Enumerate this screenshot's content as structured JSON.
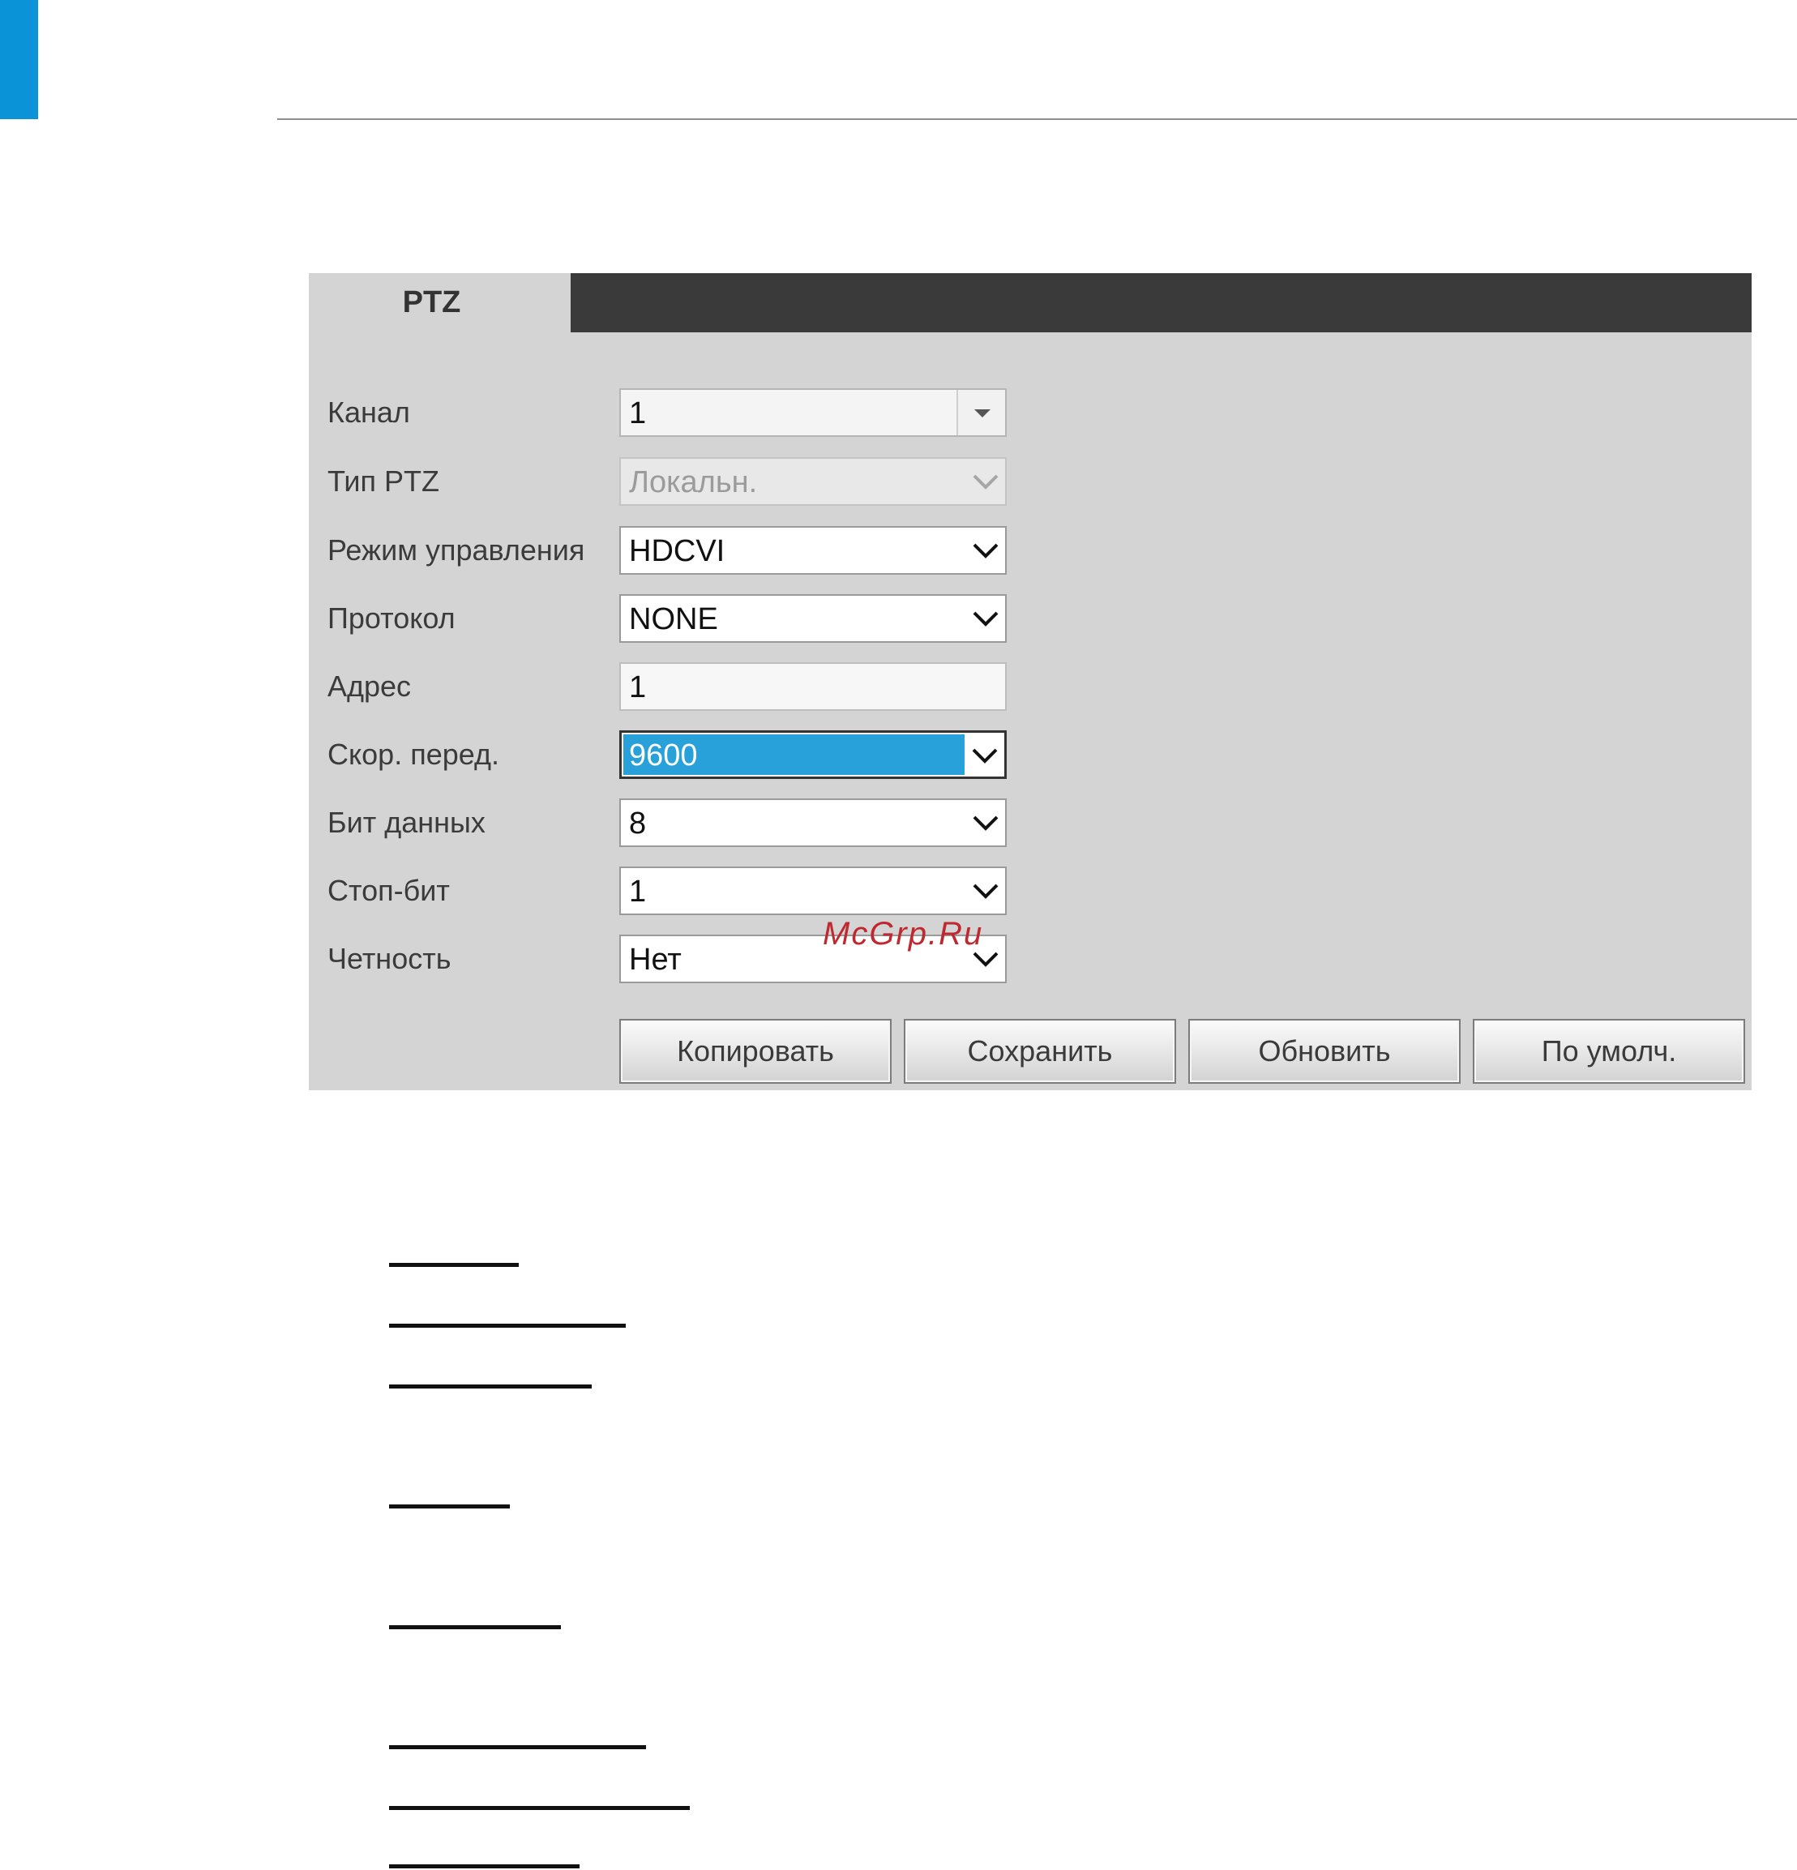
{
  "panel": {
    "tab_label": "PTZ",
    "rows": [
      {
        "label": "Канал",
        "value": "1",
        "kind": "combo"
      },
      {
        "label": "Тип PTZ",
        "value": "Локальн.",
        "kind": "disabled"
      },
      {
        "label": "Режим управления",
        "value": "HDCVI",
        "kind": "select"
      },
      {
        "label": "Протокол",
        "value": "NONE",
        "kind": "select"
      },
      {
        "label": "Адрес",
        "value": "1",
        "kind": "input"
      },
      {
        "label": "Скор. перед.",
        "value": "9600",
        "kind": "select-focused"
      },
      {
        "label": "Бит данных",
        "value": "8",
        "kind": "select"
      },
      {
        "label": "Стоп-бит",
        "value": "1",
        "kind": "select"
      },
      {
        "label": "Четность",
        "value": "Нет",
        "kind": "select"
      }
    ],
    "buttons": {
      "copy": "Копировать",
      "save": "Сохранить",
      "refresh": "Обновить",
      "default": "По умолч."
    }
  },
  "watermark": "McGrp.Ru",
  "colors": {
    "accent": "#0a93d6",
    "topbar": "#3a3a3a",
    "panel_bg": "#d4d4d4",
    "selection": "#28a0da",
    "watermark": "#c0282f"
  }
}
